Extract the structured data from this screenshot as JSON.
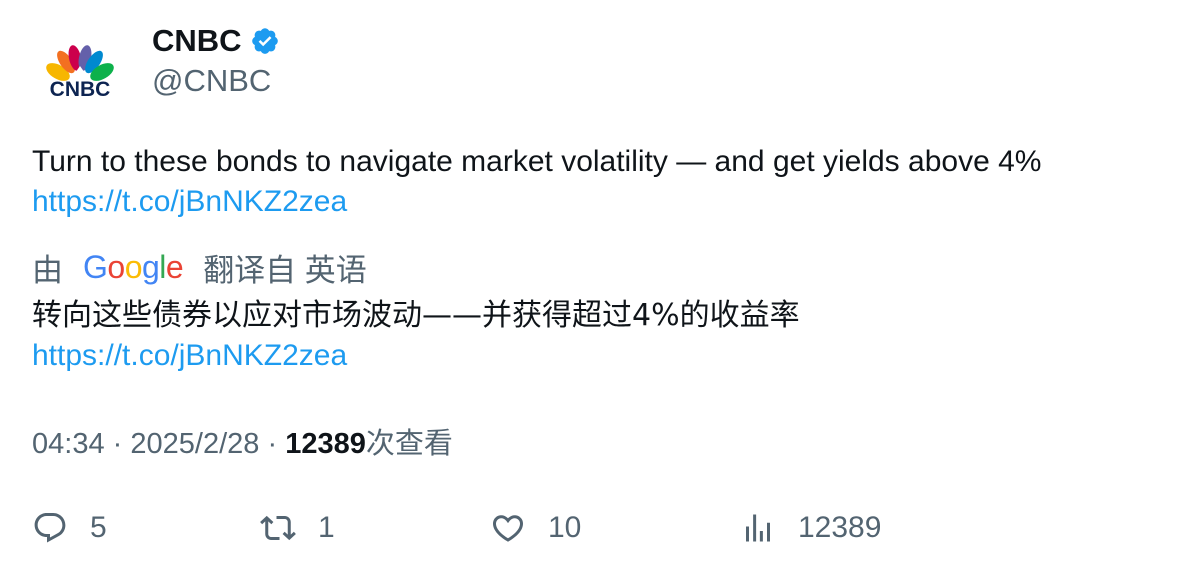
{
  "author": {
    "logo_text": "CNBC",
    "name": "CNBC",
    "handle": "@CNBC",
    "verified_icon": "verified-badge-icon"
  },
  "tweet": {
    "text": "Turn to these bonds to navigate market volatility — and get yields above 4%",
    "link": "https://t.co/jBnNKZ2zea"
  },
  "translation": {
    "prefix": "由",
    "provider": "Google",
    "suffix": "翻译自 英语",
    "text": "转向这些债券以应对市场波动——并获得超过4%的收益率",
    "link": "https://t.co/jBnNKZ2zea"
  },
  "meta": {
    "time": "04:34",
    "separator": "·",
    "date": "2025/2/28",
    "views_count": "12389",
    "views_label": "次查看"
  },
  "actions": {
    "replies": "5",
    "retweets": "1",
    "likes": "10",
    "views": "12389"
  },
  "colors": {
    "link": "#1d9bf0",
    "muted": "#536471",
    "text": "#0f1419",
    "verified": "#1d9bf0"
  }
}
